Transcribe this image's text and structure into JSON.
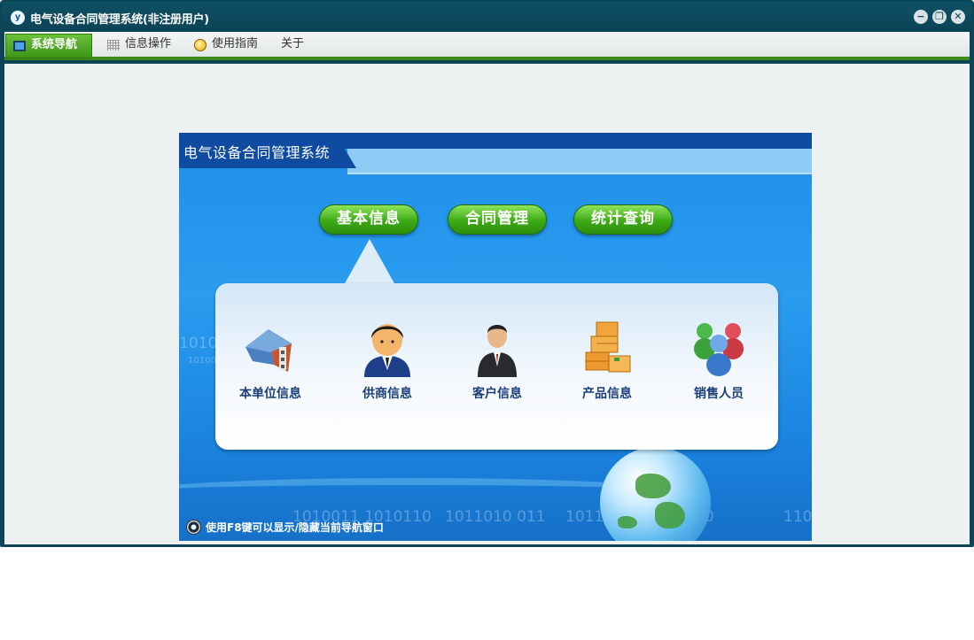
{
  "window": {
    "title": "电气设备合同管理系统(非注册用户)",
    "controls": {
      "minimize": "−",
      "restore": "❐",
      "close": "✕"
    }
  },
  "menu": {
    "items": [
      {
        "label": "系统导航",
        "icon": "monitor-icon",
        "active": true
      },
      {
        "label": "信息操作",
        "icon": "grid-icon",
        "active": false
      },
      {
        "label": "使用指南",
        "icon": "lightbulb-icon",
        "active": false
      },
      {
        "label": "关于",
        "icon": "",
        "active": false
      }
    ]
  },
  "panel": {
    "title": "电气设备合同管理系统",
    "tabs": [
      "基本信息",
      "合同管理",
      "统计查询"
    ],
    "active_tab": "基本信息",
    "items": [
      {
        "label": "本单位信息",
        "icon": "company-building-icon"
      },
      {
        "label": "供商信息",
        "icon": "supplier-person-icon"
      },
      {
        "label": "客户信息",
        "icon": "customer-businessman-icon"
      },
      {
        "label": "产品信息",
        "icon": "product-boxes-icon"
      },
      {
        "label": "销售人员",
        "icon": "sales-team-icon"
      }
    ],
    "tip": "使用F8键可以显示/隐藏当前导航窗口",
    "background_digits": [
      "1010",
      "10100",
      "1010011 1010110",
      "1011010  011",
      "1011011010  10010",
      "110"
    ]
  },
  "colors": {
    "titlebar": "#0c4557",
    "menu_accent": "#3e8a1a",
    "panel_blue": "#1f8ee8",
    "pill_green": "#3caa15",
    "label_navy": "#1b3f7a"
  }
}
